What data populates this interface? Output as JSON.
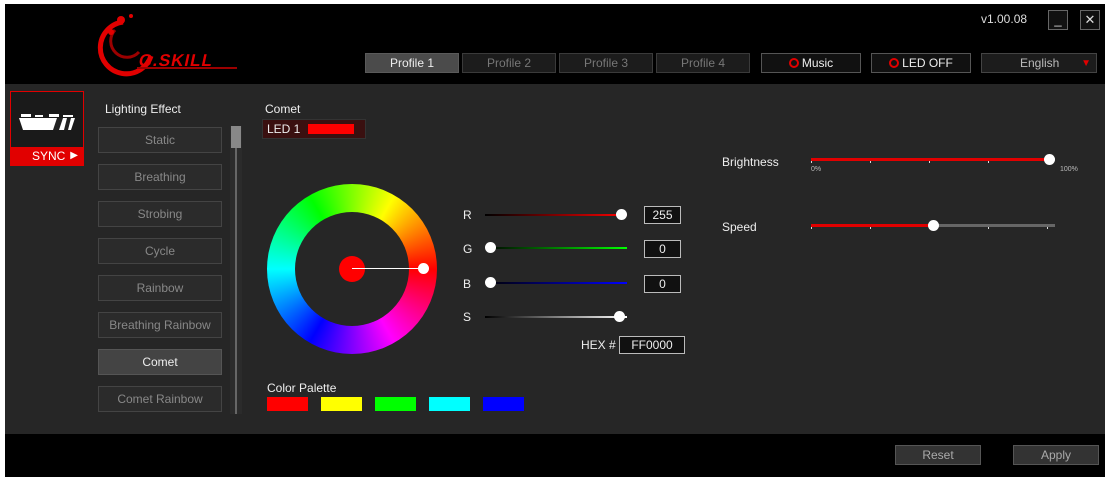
{
  "app": {
    "brand": "G.SKILL",
    "version": "v1.00.08"
  },
  "window": {
    "minimize_glyph": "_",
    "close_glyph": "✕"
  },
  "profiles": [
    {
      "label": "Profile 1",
      "active": true
    },
    {
      "label": "Profile 2",
      "active": false
    },
    {
      "label": "Profile 3",
      "active": false
    },
    {
      "label": "Profile 4",
      "active": false
    }
  ],
  "toolbar": {
    "music_label": "Music",
    "led_off_label": "LED OFF",
    "language": "English"
  },
  "device": {
    "sync_label": "SYNC"
  },
  "lighting": {
    "title": "Lighting Effect",
    "effects": [
      {
        "label": "Static"
      },
      {
        "label": "Breathing"
      },
      {
        "label": "Strobing"
      },
      {
        "label": "Cycle"
      },
      {
        "label": "Rainbow"
      },
      {
        "label": "Breathing Rainbow"
      },
      {
        "label": "Comet",
        "active": true
      },
      {
        "label": "Comet Rainbow"
      }
    ]
  },
  "editor": {
    "effect_name": "Comet",
    "led_label": "LED 1",
    "led_color": "#ff0000",
    "channels": [
      {
        "label": "R",
        "value": "255"
      },
      {
        "label": "G",
        "value": "0"
      },
      {
        "label": "B",
        "value": "0"
      },
      {
        "label": "S",
        "value": ""
      }
    ],
    "saturation_fraction": 1.0,
    "hex_label": "HEX #",
    "hex_value": "FF0000",
    "palette_title": "Color Palette",
    "palette": [
      "#ff0000",
      "#ffff00",
      "#00ff00",
      "#00ffff",
      "#0000ff"
    ]
  },
  "controls": {
    "brightness_label": "Brightness",
    "brightness_fraction": 1.0,
    "brightness_min": "0%",
    "brightness_max": "100%",
    "speed_label": "Speed",
    "speed_fraction": 0.5
  },
  "footer": {
    "reset_label": "Reset",
    "apply_label": "Apply"
  },
  "colors": {
    "accent": "#e10000"
  }
}
